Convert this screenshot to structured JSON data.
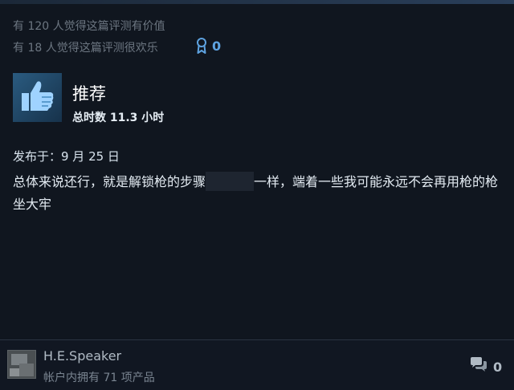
{
  "review": {
    "helpful_text": "有 120 人觉得这篇评测有价值",
    "funny_text": "有 18 人觉得这篇评测很欢乐",
    "award_count": "0",
    "verdict": "推荐",
    "hours": "总时数 11.3 小时",
    "posted": "发布于：9 月 25 日",
    "body_part1": "总体来说还行，就是解锁枪的步骤",
    "body_part2": "一样，端着一些我可能永远不会再用枪的枪坐大牢"
  },
  "author": {
    "name": "H.E.Speaker",
    "products": "帐户内拥有 71 项产品",
    "comment_count": "0"
  },
  "colors": {
    "background": "#10161f",
    "award_blue": "#5ea3e1",
    "thumb_blue": "#2a5b80"
  },
  "icons": {
    "award": "award-ribbon-icon",
    "thumb": "thumbs-up-icon",
    "comment": "comment-bubble-icon"
  }
}
